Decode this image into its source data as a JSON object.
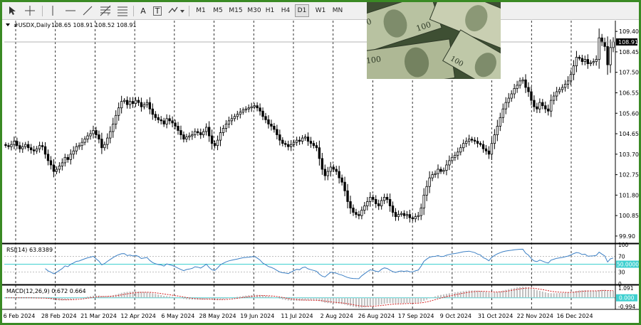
{
  "toolbar": {
    "timeframes": [
      "M1",
      "M5",
      "M15",
      "M30",
      "H1",
      "H4",
      "D1",
      "W1",
      "MN"
    ],
    "active_timeframe": "D1",
    "tools": [
      "cursor-icon",
      "crosshair-icon",
      "vertical-line-icon",
      "horizontal-line-icon",
      "trendline-icon",
      "fibonacci-icon",
      "equidistant-channel-icon",
      "text-icon",
      "text-label-icon",
      "arrows-icon"
    ],
    "text_tool_label": "A",
    "label_tool_label": "T"
  },
  "colors": {
    "frame": "#3a8a24",
    "rsi_line": "#3b7fc4",
    "rsi_level": "#3fd0d0",
    "macd_hist": "#c0c0c0",
    "macd_signal": "#d42020",
    "price_bg": "#000000"
  },
  "chart_data": [
    {
      "type": "candlestick",
      "symbol_header": "#USDX,Daily",
      "ohlc_header": "108.65 108.91 108.52 108.91",
      "current_price": 108.91,
      "y_ticks": [
        109.4,
        108.45,
        107.5,
        106.55,
        105.6,
        104.65,
        103.7,
        102.75,
        101.8,
        100.85,
        99.9
      ],
      "ylim": [
        99.6,
        109.9
      ],
      "x_labels": [
        "6 Feb 2024",
        "28 Feb 2024",
        "21 Mar 2024",
        "12 Apr 2024",
        "6 May 2024",
        "28 May 2024",
        "19 Jun 2024",
        "11 Jul 2024",
        "2 Aug 2024",
        "26 Aug 2024",
        "17 Sep 2024",
        "9 Oct 2024",
        "31 Oct 2024",
        "22 Nov 2024",
        "16 Dec 2024"
      ],
      "closes": [
        104.1,
        104.05,
        104.15,
        104.3,
        104.1,
        103.95,
        104.05,
        104.15,
        104.0,
        103.9,
        103.85,
        103.95,
        104.1,
        104.05,
        103.7,
        103.4,
        103.2,
        102.9,
        103.0,
        103.15,
        103.3,
        103.55,
        103.45,
        103.7,
        103.85,
        104.05,
        104.1,
        104.25,
        104.4,
        104.55,
        104.65,
        104.8,
        104.6,
        104.4,
        104.0,
        104.15,
        104.45,
        104.75,
        105.1,
        105.5,
        105.85,
        106.15,
        106.2,
        106.0,
        106.15,
        106.05,
        106.2,
        106.1,
        105.9,
        106.0,
        106.1,
        105.8,
        105.55,
        105.4,
        105.3,
        105.25,
        105.1,
        105.35,
        105.25,
        105.15,
        105.0,
        104.8,
        104.6,
        104.4,
        104.5,
        104.55,
        104.6,
        104.75,
        104.7,
        104.6,
        104.75,
        104.95,
        104.55,
        104.2,
        104.1,
        104.35,
        104.7,
        104.9,
        105.1,
        105.25,
        105.35,
        105.45,
        105.55,
        105.65,
        105.75,
        105.8,
        105.85,
        105.9,
        105.95,
        105.85,
        105.7,
        105.45,
        105.3,
        105.1,
        105.0,
        104.85,
        104.6,
        104.35,
        104.2,
        104.15,
        104.05,
        104.15,
        104.25,
        104.35,
        104.3,
        104.45,
        104.5,
        104.3,
        104.2,
        104.1,
        104.0,
        103.5,
        103.0,
        102.7,
        102.9,
        103.1,
        103.0,
        102.9,
        102.6,
        102.4,
        102.0,
        101.5,
        101.2,
        101.0,
        100.9,
        100.85,
        101.1,
        101.3,
        101.5,
        101.7,
        101.6,
        101.4,
        101.3,
        101.55,
        101.7,
        101.6,
        101.3,
        101.0,
        100.8,
        100.9,
        100.95,
        100.85,
        100.9,
        100.75,
        100.7,
        100.8,
        100.85,
        101.2,
        101.8,
        102.2,
        102.6,
        102.75,
        102.8,
        103.0,
        102.9,
        102.95,
        103.2,
        103.4,
        103.55,
        103.65,
        103.8,
        104.0,
        104.2,
        104.3,
        104.4,
        104.35,
        104.3,
        104.2,
        104.15,
        103.95,
        103.85,
        103.7,
        104.2,
        104.6,
        105.0,
        105.4,
        105.8,
        106.1,
        106.3,
        106.5,
        106.75,
        106.9,
        107.1,
        107.15,
        106.8,
        106.6,
        106.2,
        105.9,
        105.8,
        106.1,
        105.95,
        105.8,
        105.7,
        106.2,
        106.4,
        106.6,
        106.7,
        106.8,
        106.95,
        107.1,
        107.4,
        107.8,
        108.2,
        108.15,
        108.0,
        108.1,
        107.9,
        107.95,
        108.0,
        108.1,
        109.1,
        108.9,
        108.7,
        107.85,
        108.65,
        108.91
      ]
    },
    {
      "type": "line",
      "name": "RSI(14)",
      "header": "RSI(14) 63.8389",
      "value_label": "50.0000",
      "levels": [
        30,
        50,
        70
      ],
      "y_ticks": [
        100,
        70,
        30,
        0
      ],
      "ylim": [
        0,
        100
      ],
      "period": 14
    },
    {
      "type": "bar",
      "name": "MACD(12,26,9)",
      "header": "MACD(12,26,9) 0.672 0.664",
      "y_ticks": [
        "1.091",
        "0.000",
        "-0.994"
      ],
      "ylim": [
        -0.994,
        1.091
      ],
      "params": [
        12,
        26,
        9
      ]
    }
  ]
}
